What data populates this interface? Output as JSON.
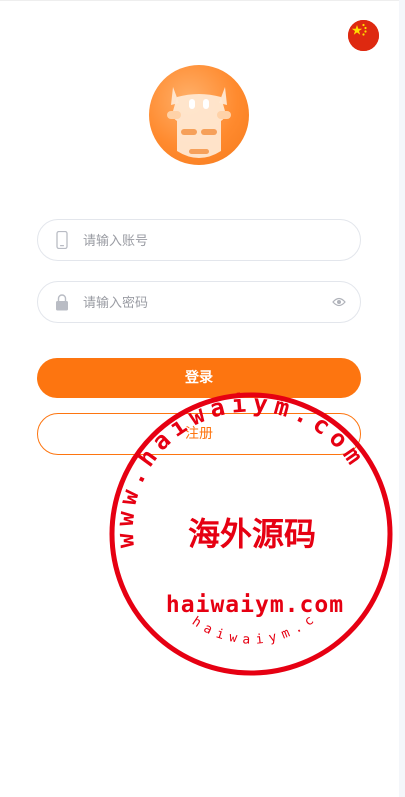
{
  "language": {
    "flag": "cn-flag-icon"
  },
  "logo": {
    "icon": "cow-logo-icon"
  },
  "login_form": {
    "account_placeholder": "请输入账号",
    "password_placeholder": "请输入密码",
    "login_label": "登录",
    "register_label": "注册"
  },
  "watermark": {
    "top_ring": "www.haiwaiym.com",
    "center_cn": "海外源码",
    "center_en": "haiwaiym.com",
    "bottom_ring": "haiwaiym.com"
  },
  "colors": {
    "accent": "#fd7510",
    "stamp_red": "#e60012",
    "input_border": "#e3e6ec",
    "placeholder": "#9a9ca3"
  }
}
